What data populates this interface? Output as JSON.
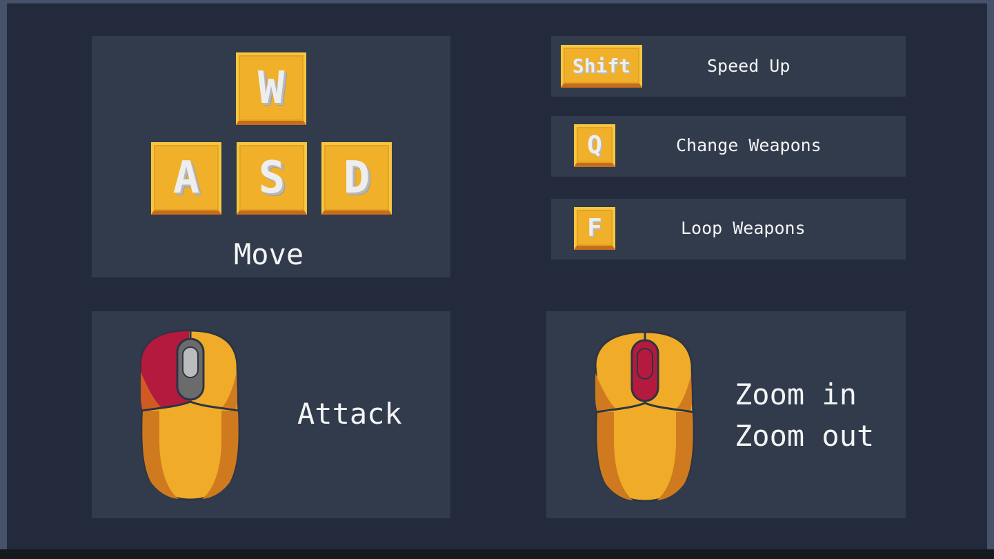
{
  "movement": {
    "keys": [
      "W",
      "A",
      "S",
      "D"
    ],
    "label": "Move"
  },
  "bindings": [
    {
      "key": "Shift",
      "action": "Speed Up"
    },
    {
      "key": "Q",
      "action": "Change Weapons"
    },
    {
      "key": "F",
      "action": "Loop Weapons"
    }
  ],
  "mouse_bindings": {
    "left_click_label": "Attack",
    "scroll_line1": "Zoom in",
    "scroll_line2": "Zoom out"
  },
  "colors": {
    "background": "#232a3b",
    "panel": "#313b4c",
    "key_face": "#f0b02a",
    "mouse_body": "#f0ac28",
    "mouse_highlight": "#b31a3d"
  }
}
